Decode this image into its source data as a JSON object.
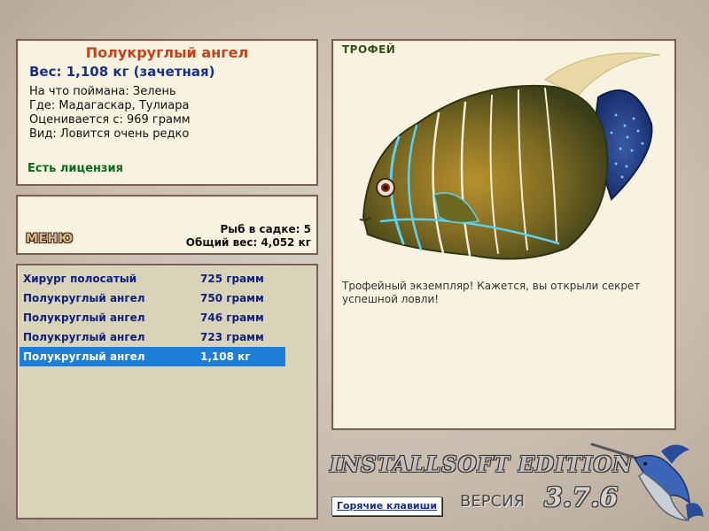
{
  "fish_info": {
    "name": "Полукруглый ангел",
    "weight": "Вес: 1,108 кг (зачетная)",
    "caught_on": "На что поймана: Зелень",
    "location": "Где: Мадагаскар, Тулиара",
    "valued_from": "Оценивается с: 969 грамм",
    "rarity": "Вид: Ловится очень редко",
    "license": "Есть лицензия"
  },
  "cage": {
    "menu_label": "МЕНЮ",
    "fish_count": "Рыб в садке: 5",
    "total_weight": "Общий вес: 4,052 кг"
  },
  "catch_list": [
    {
      "name": "Хирург полосатый",
      "weight": "725 грамм",
      "selected": false
    },
    {
      "name": "Полукруглый ангел",
      "weight": "750 грамм",
      "selected": false
    },
    {
      "name": "Полукруглый ангел",
      "weight": "746 грамм",
      "selected": false
    },
    {
      "name": "Полукруглый ангел",
      "weight": "723 грамм",
      "selected": false
    },
    {
      "name": "Полукруглый ангел",
      "weight": "1,108 кг",
      "selected": true
    }
  ],
  "trophy": {
    "label": "ТРОФЕЙ",
    "text": "Трофейный экземпляр! Кажется, вы открыли секрет успешной ловли!",
    "image": "angelfish-illustration"
  },
  "footer": {
    "brand": "INSTALLSOFT EDITION",
    "version_label": "ВЕРСИЯ",
    "version_number": "3.7.6",
    "hotkeys_label": "Горячие клавиши",
    "logo": "marlin-logo"
  },
  "colors": {
    "selection": "#1c7ed6",
    "fish_name": "#c0431a",
    "list_text": "#11207a",
    "license": "#0f6a1b"
  }
}
